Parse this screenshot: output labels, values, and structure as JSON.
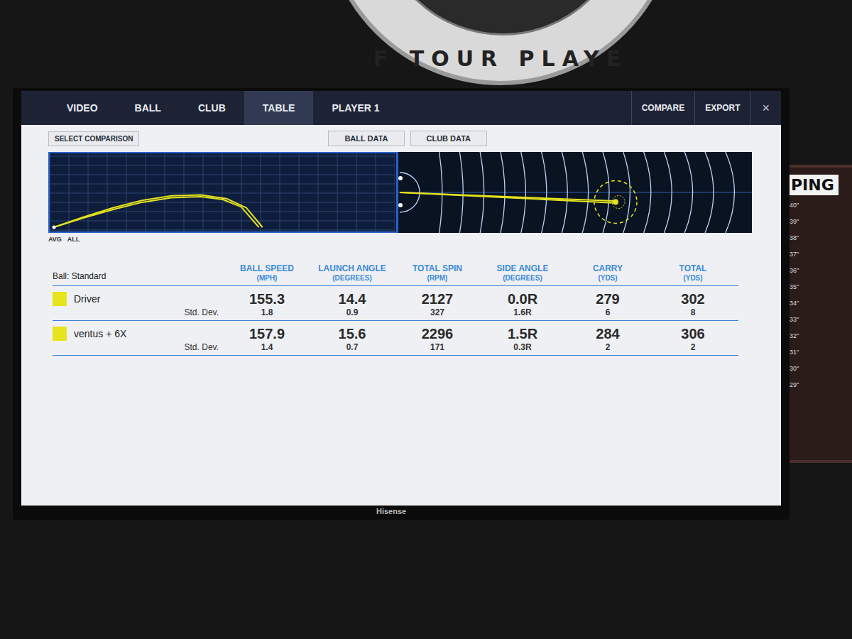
{
  "background": {
    "badge_text": "F TOUR PLAYE",
    "tv_brand": "Hisense",
    "ping_logo": "PING",
    "ping_ruler": [
      "40\"",
      "39\"",
      "38\"",
      "37\"",
      "36\"",
      "35\"",
      "34\"",
      "33\"",
      "32\"",
      "31\"",
      "30\"",
      "29\""
    ]
  },
  "nav": {
    "tabs": [
      {
        "label": "VIDEO",
        "selected": false
      },
      {
        "label": "BALL",
        "selected": false
      },
      {
        "label": "CLUB",
        "selected": false
      },
      {
        "label": "TABLE",
        "selected": true
      },
      {
        "label": "PLAYER 1",
        "selected": false
      }
    ],
    "actions": [
      "COMPARE",
      "EXPORT"
    ],
    "close": "×"
  },
  "toolbar": {
    "select_comparison": "SELECT COMPARISON",
    "views": [
      "BALL DATA",
      "CLUB DATA"
    ]
  },
  "chart": {
    "side_view": {
      "labels": [
        "AVG",
        "ALL"
      ],
      "series": [
        {
          "name": "Driver",
          "distance": [
            0,
            40,
            80,
            120,
            160,
            200,
            230,
            255,
            279
          ],
          "height": [
            0,
            10,
            19,
            27,
            32,
            33,
            30,
            22,
            0
          ]
        },
        {
          "name": "ventus + 6X",
          "distance": [
            0,
            40,
            80,
            120,
            160,
            200,
            235,
            262,
            284
          ],
          "height": [
            0,
            11,
            21,
            29,
            34,
            35,
            31,
            21,
            0
          ]
        }
      ]
    },
    "top_view": {
      "series": [
        {
          "name": "Driver",
          "distance": [
            0,
            302
          ],
          "lateral": [
            0,
            4
          ]
        },
        {
          "name": "ventus + 6X",
          "distance": [
            0,
            306
          ],
          "lateral": [
            0,
            5
          ]
        }
      ]
    }
  },
  "table": {
    "ball_label": "Ball: Standard",
    "columns": [
      {
        "title": "BALL SPEED",
        "unit": "(MPH)"
      },
      {
        "title": "LAUNCH ANGLE",
        "unit": "(DEGREES)"
      },
      {
        "title": "TOTAL SPIN",
        "unit": "(RPM)"
      },
      {
        "title": "SIDE ANGLE",
        "unit": "(DEGREES)"
      },
      {
        "title": "CARRY",
        "unit": "(YDS)"
      },
      {
        "title": "TOTAL",
        "unit": "(YDS)"
      }
    ],
    "rows": [
      {
        "name": "Driver",
        "color": "#e6e41c",
        "values": [
          "155.3",
          "14.4",
          "2127",
          "0.0R",
          "279",
          "302"
        ],
        "std_label": "Std. Dev.",
        "std": [
          "1.8",
          "0.9",
          "327",
          "1.6R",
          "6",
          "8"
        ]
      },
      {
        "name": "ventus + 6X",
        "color": "#e6e41c",
        "values": [
          "157.9",
          "15.6",
          "2296",
          "1.5R",
          "284",
          "306"
        ],
        "std_label": "Std. Dev.",
        "std": [
          "1.4",
          "0.7",
          "171",
          "0.3R",
          "2",
          "2"
        ]
      }
    ]
  }
}
